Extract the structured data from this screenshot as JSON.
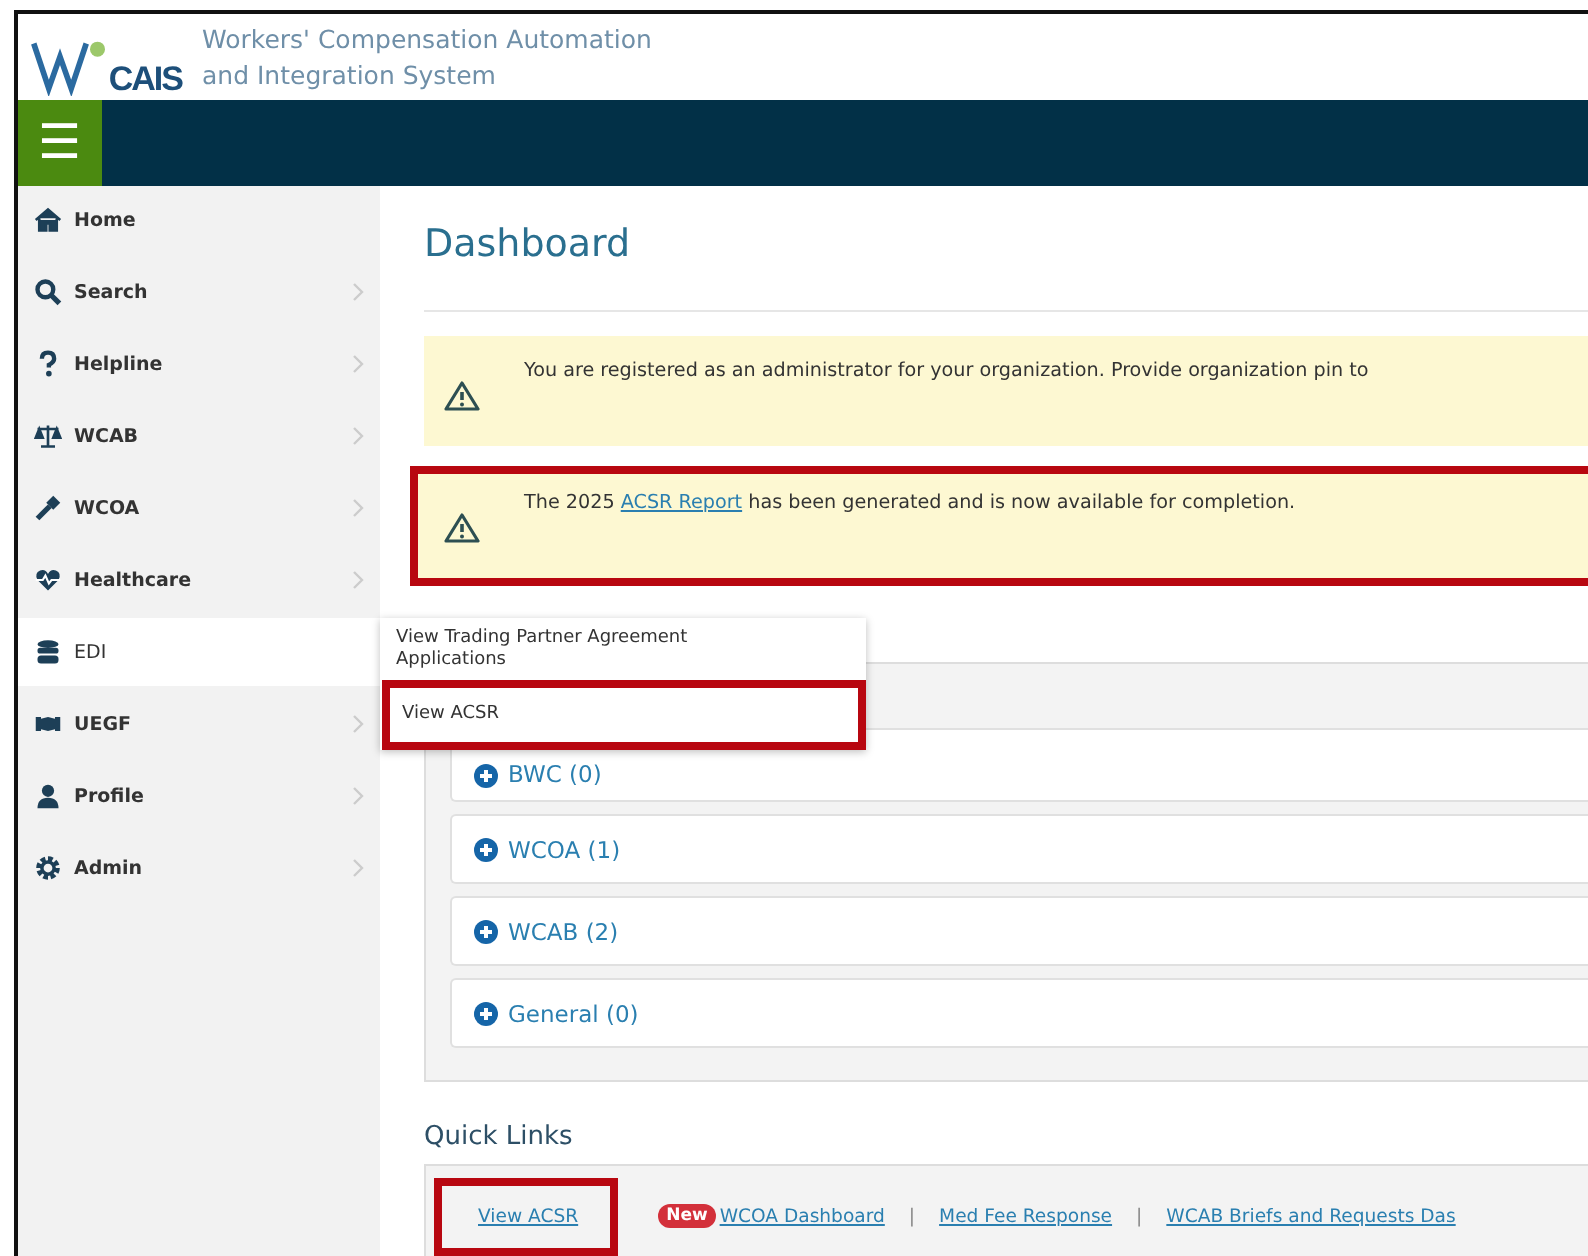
{
  "header": {
    "logo_text": "CAIS",
    "title_lines": [
      "Workers' Compensation Automation",
      "and Integration System"
    ]
  },
  "nav_bar": {
    "menu_label": "☰"
  },
  "sidebar": {
    "items": [
      {
        "label": "Home",
        "has_submenu": false,
        "selected": false
      },
      {
        "label": "Search",
        "has_submenu": true,
        "selected": false
      },
      {
        "label": "Helpline",
        "has_submenu": true,
        "selected": false
      },
      {
        "label": "WCAB",
        "has_submenu": true,
        "selected": false
      },
      {
        "label": "WCOA",
        "has_submenu": true,
        "selected": false
      },
      {
        "label": "Healthcare",
        "has_submenu": true,
        "selected": false
      },
      {
        "label": "EDI",
        "has_submenu": false,
        "selected": true
      },
      {
        "label": "UEGF",
        "has_submenu": true,
        "selected": false
      },
      {
        "label": "Profile",
        "has_submenu": true,
        "selected": false
      },
      {
        "label": "Admin",
        "has_submenu": true,
        "selected": false
      }
    ]
  },
  "flyout_menu": {
    "items": [
      {
        "label": "View Trading Partner Agreement Applications",
        "highlighted": false
      },
      {
        "label": "View ACSR",
        "highlighted": true
      }
    ]
  },
  "main": {
    "title": "Dashboard",
    "alerts": [
      {
        "text": "You are registered as an administrator for your organization. Provide organization pin to",
        "highlighted": false
      },
      {
        "text": "The 2025",
        "link": "ACSR Report",
        "text_after": "has been generated and is now available for completion.",
        "highlighted": true
      }
    ],
    "accordion": [
      {
        "label": "BWC (0)"
      },
      {
        "label": "WCOA (1)"
      },
      {
        "label": "WCAB (2)"
      },
      {
        "label": "General (0)"
      }
    ],
    "quick_links_title": "Quick Links",
    "quick_links": [
      {
        "kind": "link",
        "label": "View ACSR",
        "highlighted": true
      },
      {
        "kind": "link",
        "label": "WCOA Dashboard",
        "badge": "New",
        "highlighted": false
      },
      {
        "kind": "separator",
        "label": "|"
      },
      {
        "kind": "link",
        "label": "Med Fee Response",
        "highlighted": false
      },
      {
        "kind": "separator",
        "label": "|"
      },
      {
        "kind": "link",
        "label": "WCAB Briefs and Requests Das",
        "highlighted": false
      }
    ]
  }
}
